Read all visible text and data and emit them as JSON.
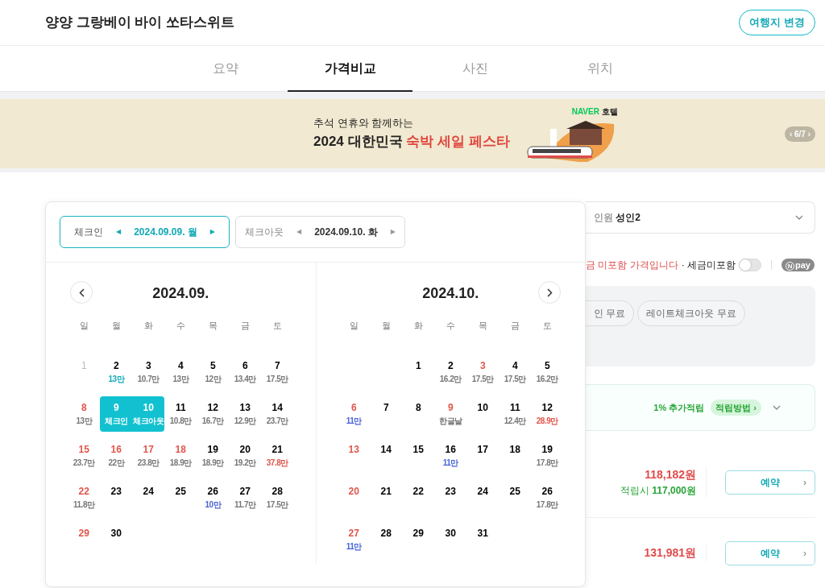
{
  "header": {
    "title": "양양 그랑베이 바이 쏘타스위트",
    "change_button": "여행지 변경"
  },
  "tabs": [
    {
      "label": "요약",
      "selected": false
    },
    {
      "label": "가격비교",
      "selected": true
    },
    {
      "label": "사진",
      "selected": false
    },
    {
      "label": "위치",
      "selected": false
    }
  ],
  "banner": {
    "line1": "추석 연휴와 함께하는",
    "title": "2024 대한민국 ",
    "title_highlight": "숙박 세일 페스타",
    "brand": "NAVER",
    "brand_sub": "호텔",
    "pager": "6/7",
    "prev": "‹",
    "next": "›"
  },
  "date_bar": [
    {
      "label": "체크인",
      "prev": "◀",
      "date": "2024.09.09. 월",
      "next": "▶",
      "selected": true
    },
    {
      "label": "체크아웃",
      "prev": "◀",
      "date": "2024.09.10. 화",
      "next": "▶",
      "selected": false
    }
  ],
  "months": [
    {
      "title": "2024.09.",
      "kind": "left",
      "weekdays": [
        "일",
        "월",
        "화",
        "수",
        "목",
        "금",
        "토"
      ],
      "weeks": [
        [
          {
            "day": "1",
            "kind": "past",
            "selected": false
          },
          {
            "day": "2",
            "kind": "weekday",
            "note": {
              "text": "13만",
              "color": "#12a9b6"
            },
            "selected": false
          },
          {
            "day": "3",
            "kind": "weekday",
            "note": {
              "text": "10.7만",
              "color": "#777777"
            },
            "selected": false
          },
          {
            "day": "4",
            "kind": "weekday",
            "note": {
              "text": "13만",
              "color": "#777777"
            },
            "selected": false
          },
          {
            "day": "5",
            "kind": "weekday",
            "note": {
              "text": "12만",
              "color": "#777777"
            },
            "selected": false
          },
          {
            "day": "6",
            "kind": "weekday",
            "note": {
              "text": "13.4만",
              "color": "#777777"
            },
            "selected": false
          },
          {
            "day": "7",
            "kind": "weekday",
            "note": {
              "text": "17.5만",
              "color": "#777777"
            },
            "selected": false
          }
        ],
        [
          {
            "day": "8",
            "kind": "holiday",
            "note": {
              "text": "13만",
              "color": "#777777"
            },
            "selected": false
          },
          {
            "day": "9",
            "kind": "weekday",
            "sel_label": "체크인",
            "selected": true
          },
          {
            "day": "10",
            "kind": "weekday",
            "sel_label": "체크아웃",
            "selected": true
          },
          {
            "day": "11",
            "kind": "weekday",
            "note": {
              "text": "10.8만",
              "color": "#777777"
            },
            "selected": false
          },
          {
            "day": "12",
            "kind": "weekday",
            "note": {
              "text": "16.7만",
              "color": "#777777"
            },
            "selected": false
          },
          {
            "day": "13",
            "kind": "weekday",
            "note": {
              "text": "12.9만",
              "color": "#777777"
            },
            "selected": false
          },
          {
            "day": "14",
            "kind": "weekday",
            "note": {
              "text": "23.7만",
              "color": "#777777"
            },
            "selected": false
          }
        ],
        [
          {
            "day": "15",
            "kind": "holiday",
            "note": {
              "text": "23.7만",
              "color": "#777777"
            },
            "selected": false
          },
          {
            "day": "16",
            "kind": "holiday",
            "note": {
              "text": "22만",
              "color": "#777777"
            },
            "selected": false
          },
          {
            "day": "17",
            "kind": "holiday",
            "note": {
              "text": "23.8만",
              "color": "#777777"
            },
            "selected": false
          },
          {
            "day": "18",
            "kind": "holiday",
            "note": {
              "text": "18.9만",
              "color": "#777777"
            },
            "selected": false
          },
          {
            "day": "19",
            "kind": "weekday",
            "note": {
              "text": "18.9만",
              "color": "#777777"
            },
            "selected": false
          },
          {
            "day": "20",
            "kind": "weekday",
            "note": {
              "text": "19.2만",
              "color": "#777777"
            },
            "selected": false
          },
          {
            "day": "21",
            "kind": "weekday",
            "note": {
              "text": "37.8만",
              "color": "#e0564c"
            },
            "selected": false
          }
        ],
        [
          {
            "day": "22",
            "kind": "holiday",
            "note": {
              "text": "11.8만",
              "color": "#777777"
            },
            "selected": false
          },
          {
            "day": "23",
            "kind": "weekday",
            "selected": false
          },
          {
            "day": "24",
            "kind": "weekday",
            "selected": false
          },
          {
            "day": "25",
            "kind": "weekday",
            "selected": false
          },
          {
            "day": "26",
            "kind": "weekday",
            "note": {
              "text": "10만",
              "color": "#4a64d6"
            },
            "selected": false
          },
          {
            "day": "27",
            "kind": "weekday",
            "note": {
              "text": "11.7만",
              "color": "#777777"
            },
            "selected": false
          },
          {
            "day": "28",
            "kind": "weekday",
            "note": {
              "text": "17.5만",
              "color": "#777777"
            },
            "selected": false
          }
        ],
        [
          {
            "day": "29",
            "kind": "holiday",
            "selected": false
          },
          {
            "day": "30",
            "kind": "weekday",
            "selected": false
          }
        ]
      ]
    },
    {
      "title": "2024.10.",
      "kind": "right",
      "weekdays": [
        "일",
        "월",
        "화",
        "수",
        "목",
        "금",
        "토"
      ],
      "weeks": [
        [
          {
            "kind": "empty"
          },
          {
            "kind": "empty"
          },
          {
            "day": "1",
            "kind": "weekday",
            "selected": false
          },
          {
            "day": "2",
            "kind": "weekday",
            "note": {
              "text": "16.2만",
              "color": "#777777"
            },
            "selected": false
          },
          {
            "day": "3",
            "kind": "holiday",
            "note": {
              "text": "17.5만",
              "color": "#777777"
            },
            "selected": false
          },
          {
            "day": "4",
            "kind": "weekday",
            "note": {
              "text": "17.5만",
              "color": "#777777"
            },
            "selected": false
          },
          {
            "day": "5",
            "kind": "weekday",
            "note": {
              "text": "16.2만",
              "color": "#777777"
            },
            "selected": false
          }
        ],
        [
          {
            "day": "6",
            "kind": "holiday",
            "note": {
              "text": "11만",
              "color": "#4a64d6"
            },
            "selected": false
          },
          {
            "day": "7",
            "kind": "weekday",
            "selected": false
          },
          {
            "day": "8",
            "kind": "weekday",
            "selected": false
          },
          {
            "day": "9",
            "kind": "holiday",
            "note": {
              "text": "한글날",
              "color": "#777777"
            },
            "selected": false
          },
          {
            "day": "10",
            "kind": "weekday",
            "selected": false
          },
          {
            "day": "11",
            "kind": "weekday",
            "note": {
              "text": "12.4만",
              "color": "#777777"
            },
            "selected": false
          },
          {
            "day": "12",
            "kind": "weekday",
            "note": {
              "text": "28.9만",
              "color": "#e0564c"
            },
            "selected": false
          }
        ],
        [
          {
            "day": "13",
            "kind": "holiday",
            "selected": false
          },
          {
            "day": "14",
            "kind": "weekday",
            "selected": false
          },
          {
            "day": "15",
            "kind": "weekday",
            "selected": false
          },
          {
            "day": "16",
            "kind": "weekday",
            "note": {
              "text": "11만",
              "color": "#4a64d6"
            },
            "selected": false
          },
          {
            "day": "17",
            "kind": "weekday",
            "selected": false
          },
          {
            "day": "18",
            "kind": "weekday",
            "selected": false
          },
          {
            "day": "19",
            "kind": "weekday",
            "note": {
              "text": "17.8만",
              "color": "#777777"
            },
            "selected": false
          }
        ],
        [
          {
            "day": "20",
            "kind": "holiday",
            "selected": false
          },
          {
            "day": "21",
            "kind": "weekday",
            "selected": false
          },
          {
            "day": "22",
            "kind": "weekday",
            "selected": false
          },
          {
            "day": "23",
            "kind": "weekday",
            "selected": false
          },
          {
            "day": "24",
            "kind": "weekday",
            "selected": false
          },
          {
            "day": "25",
            "kind": "weekday",
            "selected": false
          },
          {
            "day": "26",
            "kind": "weekday",
            "note": {
              "text": "17.8만",
              "color": "#777777"
            },
            "selected": false
          }
        ],
        [
          {
            "day": "27",
            "kind": "holiday",
            "note": {
              "text": "11만",
              "color": "#4a64d6"
            },
            "selected": false
          },
          {
            "day": "28",
            "kind": "weekday",
            "selected": false
          },
          {
            "day": "29",
            "kind": "weekday",
            "selected": false
          },
          {
            "day": "30",
            "kind": "weekday",
            "selected": false
          },
          {
            "day": "31",
            "kind": "weekday",
            "selected": false
          }
        ]
      ]
    }
  ],
  "guests": {
    "label": "인원",
    "value": "성인2"
  },
  "tax": {
    "notice": "금 미포함 가격입니다",
    "toggle_label": "· 세금미포함",
    "toggle_on": false,
    "pay_mark": "N",
    "pay": "pay"
  },
  "chips": [
    "인 무료",
    "레이트체크아웃 무료"
  ],
  "savings": {
    "text": "1% 추가적립",
    "button": "적립방법 ›"
  },
  "offers": [
    {
      "price": "118,182원",
      "points_label": "적립시",
      "points_price": "117,000원",
      "button": "예약",
      "arrow": "›"
    },
    {
      "price": "131,981원",
      "button": "예약",
      "arrow": "›"
    }
  ]
}
